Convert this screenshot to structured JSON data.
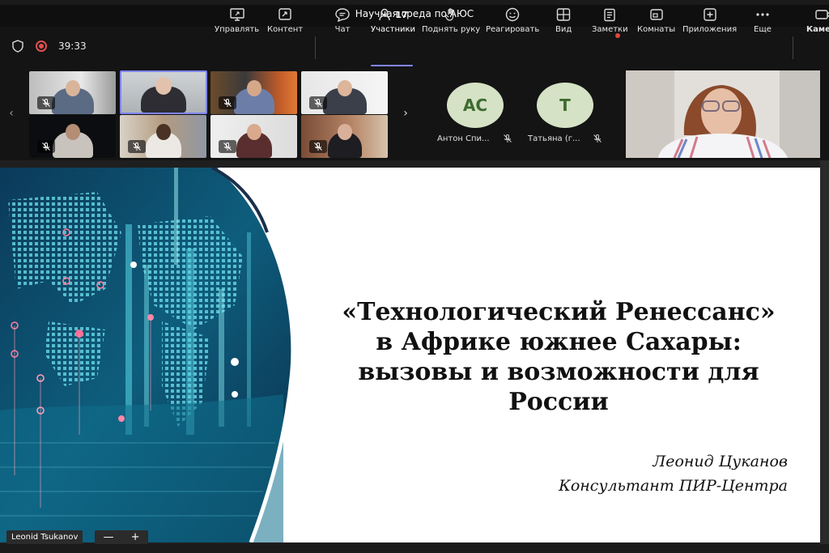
{
  "window": {
    "title": "Научная среда по АЮС"
  },
  "call": {
    "timer": "39:33"
  },
  "toolbar": {
    "manage": "Управлять",
    "content": "Контент",
    "chat": "Чат",
    "participants": "Участники",
    "participants_count": "17",
    "raise_hand": "Поднять руку",
    "react": "Реагировать",
    "view": "Вид",
    "notes": "Заметки",
    "rooms": "Комнаты",
    "apps": "Приложения",
    "more": "Еще",
    "camera": "Камера"
  },
  "participants": {
    "avatars": [
      {
        "initials": "АС",
        "name": "Антон Спи...",
        "bg": "#d5e2c5",
        "fg": "#3d6b30"
      },
      {
        "initials": "Т",
        "name": "Татьяна (г...",
        "bg": "#d5e2c5",
        "fg": "#3d6b30"
      }
    ]
  },
  "slide": {
    "title_lines": [
      "«Технологический Ренессанс»",
      "в Африке южнее Сахары:",
      "вызовы и возможности для",
      "России"
    ],
    "author": "Леонид Цуканов",
    "role": "Консультант ПИР-Центра"
  },
  "presenter": {
    "name": "Leonid Tsukanov"
  },
  "zoom": {
    "minus": "—",
    "plus": "+"
  },
  "colors": {
    "accent": "#7f85f5",
    "record": "#e05050",
    "slide_bg": "#ffffff"
  }
}
